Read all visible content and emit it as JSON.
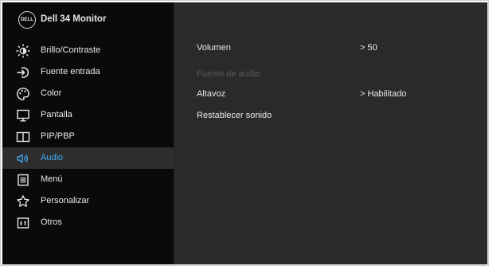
{
  "header": {
    "logo": "DELL",
    "title": "Dell  34 Monitor"
  },
  "menu": {
    "items": [
      {
        "label": "Brillo/Contraste",
        "icon": "brightness-icon"
      },
      {
        "label": "Fuente entrada",
        "icon": "input-source-icon"
      },
      {
        "label": "Color",
        "icon": "color-palette-icon"
      },
      {
        "label": "Pantalla",
        "icon": "display-icon"
      },
      {
        "label": "PIP/PBP",
        "icon": "pip-pbp-icon"
      },
      {
        "label": "Audio",
        "icon": "speaker-icon",
        "active": true
      },
      {
        "label": "Menú",
        "icon": "menu-icon"
      },
      {
        "label": "Personalizar",
        "icon": "star-icon"
      },
      {
        "label": "Otros",
        "icon": "others-icon"
      }
    ]
  },
  "audio": {
    "volume": {
      "label": "Volumen",
      "value": "> 50"
    },
    "audio_source": {
      "label": "Fuente de audio",
      "disabled": true
    },
    "speaker": {
      "label": "Altavoz",
      "value": "> Habilitado"
    },
    "reset_sound": {
      "label": "Restablecer sonido"
    }
  },
  "colors": {
    "accent": "#41a8f0",
    "sidebar_bg": "#0a0a0a",
    "panel_bg": "#2a2a2a",
    "text": "#e8e8e8",
    "disabled_text": "#5b5b5b"
  }
}
